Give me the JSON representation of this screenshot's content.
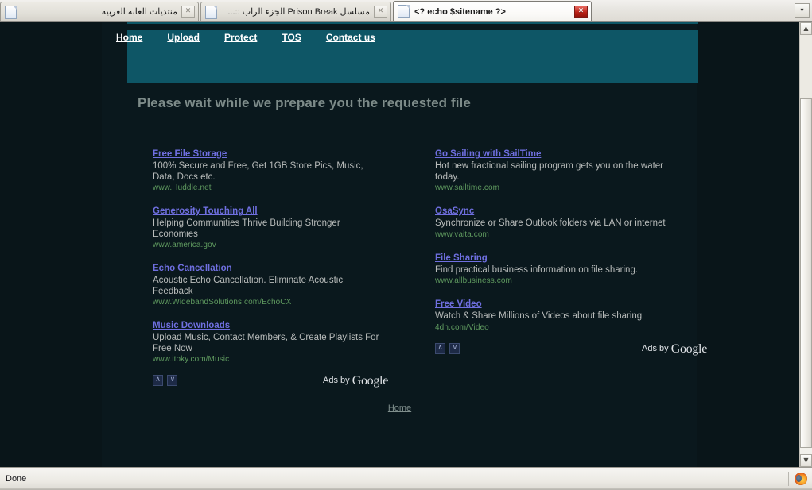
{
  "browser": {
    "tabs": [
      {
        "title": "منتديات الغابة العربية",
        "active": false,
        "close_label": "✕",
        "favicon": "document-icon"
      },
      {
        "title": "مسلسل Prison Break الجزء الراب ::...",
        "active": false,
        "close_label": "✕",
        "favicon": "document-icon"
      },
      {
        "title": "<? echo $sitename ?>",
        "active": true,
        "close_label": "✕",
        "favicon": "document-icon"
      }
    ],
    "tab_list_button": "▾",
    "status": {
      "text": "Done",
      "indicator_icon": "firefox-icon"
    },
    "scrollbar": {
      "up_arrow": "▲",
      "down_arrow": "▼"
    }
  },
  "site": {
    "nav": [
      {
        "label": "Home"
      },
      {
        "label": "Upload"
      },
      {
        "label": "Protect"
      },
      {
        "label": "TOS"
      },
      {
        "label": "Contact us"
      }
    ],
    "heading": "Please wait while we prepare you the requested file",
    "footer_link": "Home",
    "colors": {
      "nav_bar": "#0e5666",
      "page_background": "#091519",
      "container_background": "#0a181d",
      "heading_text": "#7d8b89",
      "ad_title": "#6f6fe0",
      "ad_desc": "#b9bcbb",
      "ad_url": "#5f9a5f"
    }
  },
  "ads": {
    "left_column": [
      {
        "title": "Free File Storage",
        "desc": "100% Secure and Free, Get 1GB Store Pics, Music, Data, Docs etc.",
        "url": "www.Huddle.net"
      },
      {
        "title": "Generosity Touching All",
        "desc": "Helping Communities Thrive Building Stronger Economies",
        "url": "www.america.gov"
      },
      {
        "title": "Echo Cancellation",
        "desc": "Acoustic Echo Cancellation. Eliminate Acoustic Feedback",
        "url": "www.WidebandSolutions.com/EchoCX"
      },
      {
        "title": "Music Downloads",
        "desc": "Upload Music, Contact Members, & Create Playlists For Free Now",
        "url": "www.itoky.com/Music"
      }
    ],
    "right_column": [
      {
        "title": "Go Sailing with SailTime",
        "desc": "Hot new fractional sailing program gets you on the water today.",
        "url": "www.sailtime.com"
      },
      {
        "title": "OsaSync",
        "desc": "Synchronize or Share Outlook folders via LAN or internet",
        "url": "www.vaita.com"
      },
      {
        "title": "File Sharing",
        "desc": "Find practical business information on file sharing.",
        "url": "www.allbusiness.com"
      },
      {
        "title": "Free Video",
        "desc": "Watch & Share Millions of Videos about file sharing",
        "url": "4dh.com/Video"
      }
    ],
    "footer": {
      "prev_arrow": "∧",
      "next_arrow": "∨",
      "ads_by_prefix": "Ads by",
      "ads_by_brand": "Google"
    }
  }
}
